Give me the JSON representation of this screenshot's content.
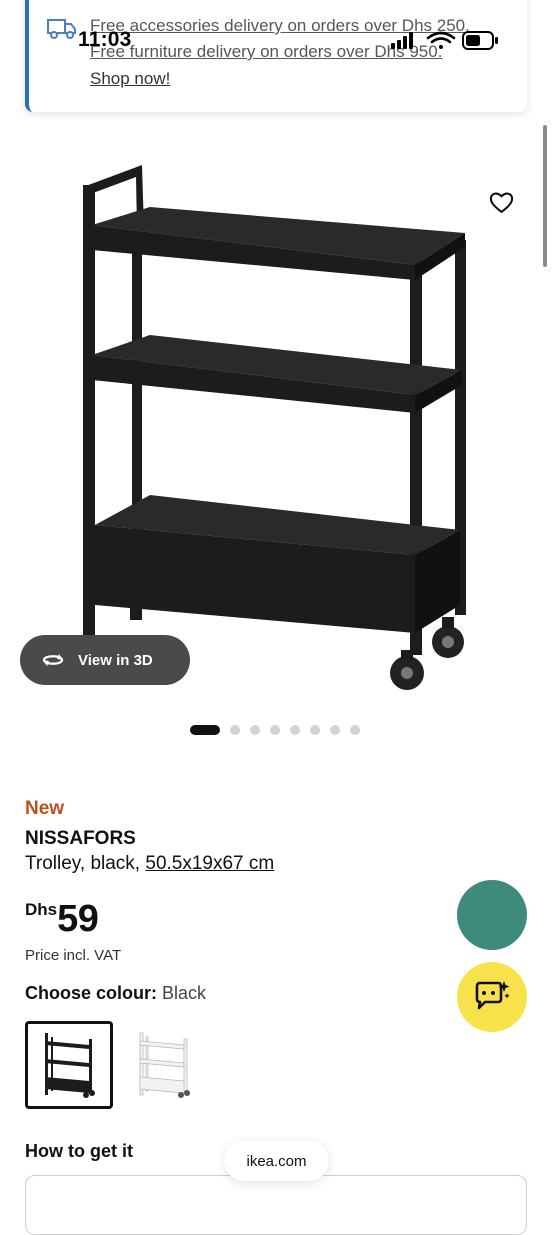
{
  "status_bar": {
    "time": "11:03",
    "battery_level": 0.6
  },
  "banner": {
    "line1": "Free accessories delivery on orders over Dhs 250.",
    "line2": "Free furniture delivery on orders over Dhs 950.",
    "link": "Shop now!",
    "icon": "delivery-truck-icon",
    "accent_color": "#2c6fb6"
  },
  "gallery": {
    "view_3d_label": "View in 3D",
    "image_count": 8,
    "active_index": 0
  },
  "product": {
    "badge": "New",
    "badge_color": "#b9511a",
    "name": "NISSAFORS",
    "description": "Trolley, black, ",
    "dimensions": "50.5x19x67 cm",
    "currency": "Dhs",
    "price": "59",
    "price_note": "Price incl. VAT",
    "colour_label": "Choose colour:",
    "colour_value": "Black",
    "colour_options": [
      "Black",
      "White"
    ]
  },
  "fab": {
    "teal_color": "#3e8a7d",
    "chat_color": "#f8e24b",
    "chat_icon": "chat-sparkle-icon"
  },
  "delivery": {
    "heading": "How to get it"
  },
  "browser": {
    "url": "ikea.com"
  }
}
